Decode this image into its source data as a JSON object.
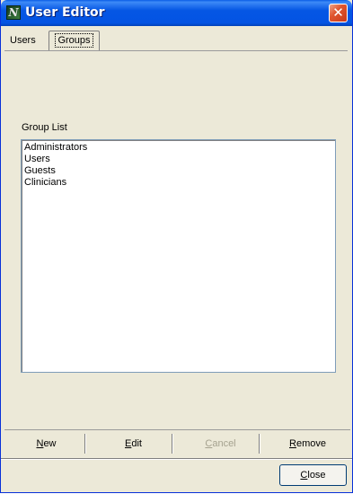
{
  "window": {
    "title": "User Editor",
    "app_icon_glyph": "N",
    "close_glyph": "✕"
  },
  "tabs": [
    {
      "label": "Users",
      "selected": false
    },
    {
      "label": "Groups",
      "selected": true
    }
  ],
  "group_list": {
    "label": "Group List",
    "items": [
      "Administrators",
      "Users",
      "Guests",
      "Clinicians"
    ]
  },
  "actions": {
    "new": {
      "mnemonic": "N",
      "rest": "ew"
    },
    "edit": {
      "mnemonic": "E",
      "rest": "dit"
    },
    "cancel": {
      "mnemonic": "C",
      "rest": "ancel",
      "enabled": false
    },
    "remove": {
      "mnemonic": "R",
      "rest": "emove"
    }
  },
  "footer": {
    "close": {
      "mnemonic": "C",
      "rest": "lose"
    }
  },
  "colors": {
    "titlebar": "#0554e3",
    "face": "#ece9d8",
    "disabled_text": "#a5a28f"
  }
}
